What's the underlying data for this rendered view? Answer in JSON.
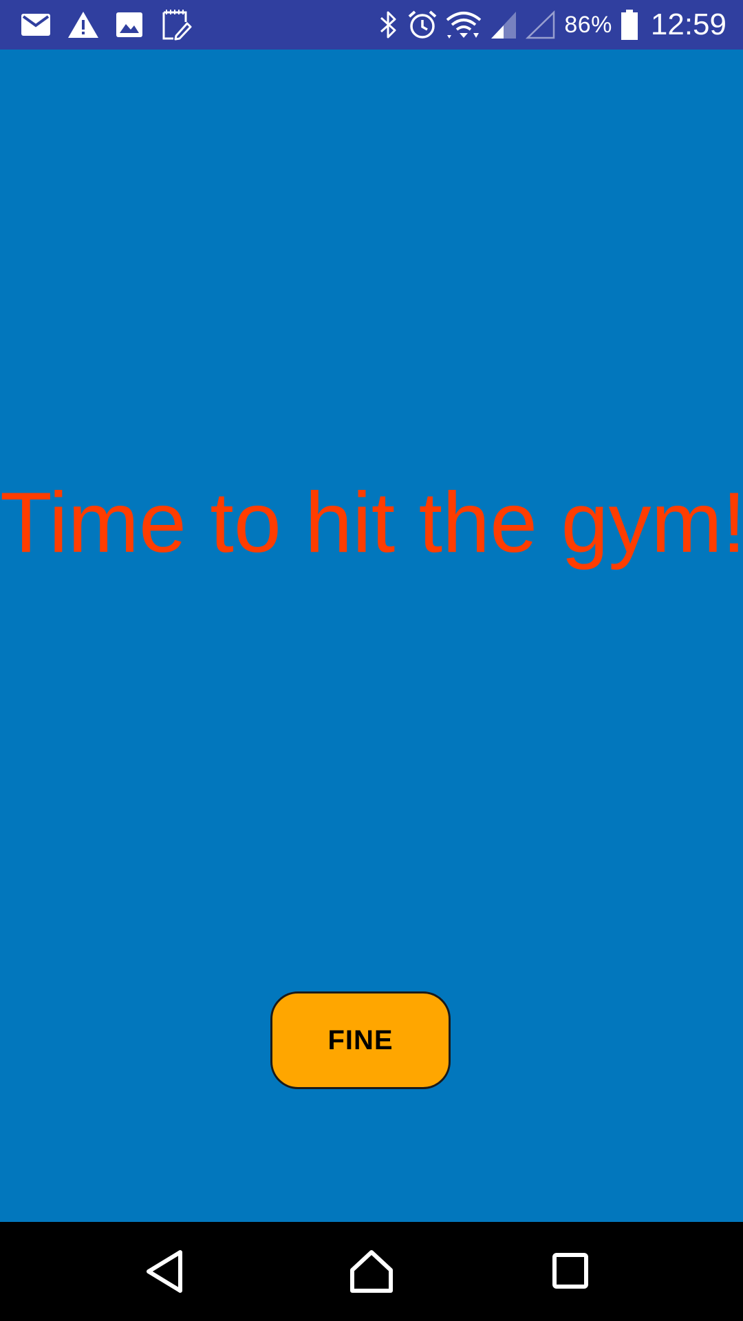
{
  "status_bar": {
    "left_icons": [
      "mail-icon",
      "warning-icon",
      "image-icon",
      "notepad-icon"
    ],
    "right_icons": [
      "bluetooth-icon",
      "alarm-icon",
      "wifi-icon",
      "signal-icon",
      "no-signal-icon",
      "battery-icon"
    ],
    "battery": "86%",
    "time": "12:59",
    "color": "#303F9F"
  },
  "main": {
    "message": "Time to hit the gym!",
    "message_color": "#FF3D00",
    "background_color": "#0277BD"
  },
  "fine_button": {
    "label": "FINE",
    "color": "#FFA600"
  },
  "nav_bar": {
    "buttons": [
      "back-icon",
      "home-icon",
      "recents-icon"
    ]
  }
}
